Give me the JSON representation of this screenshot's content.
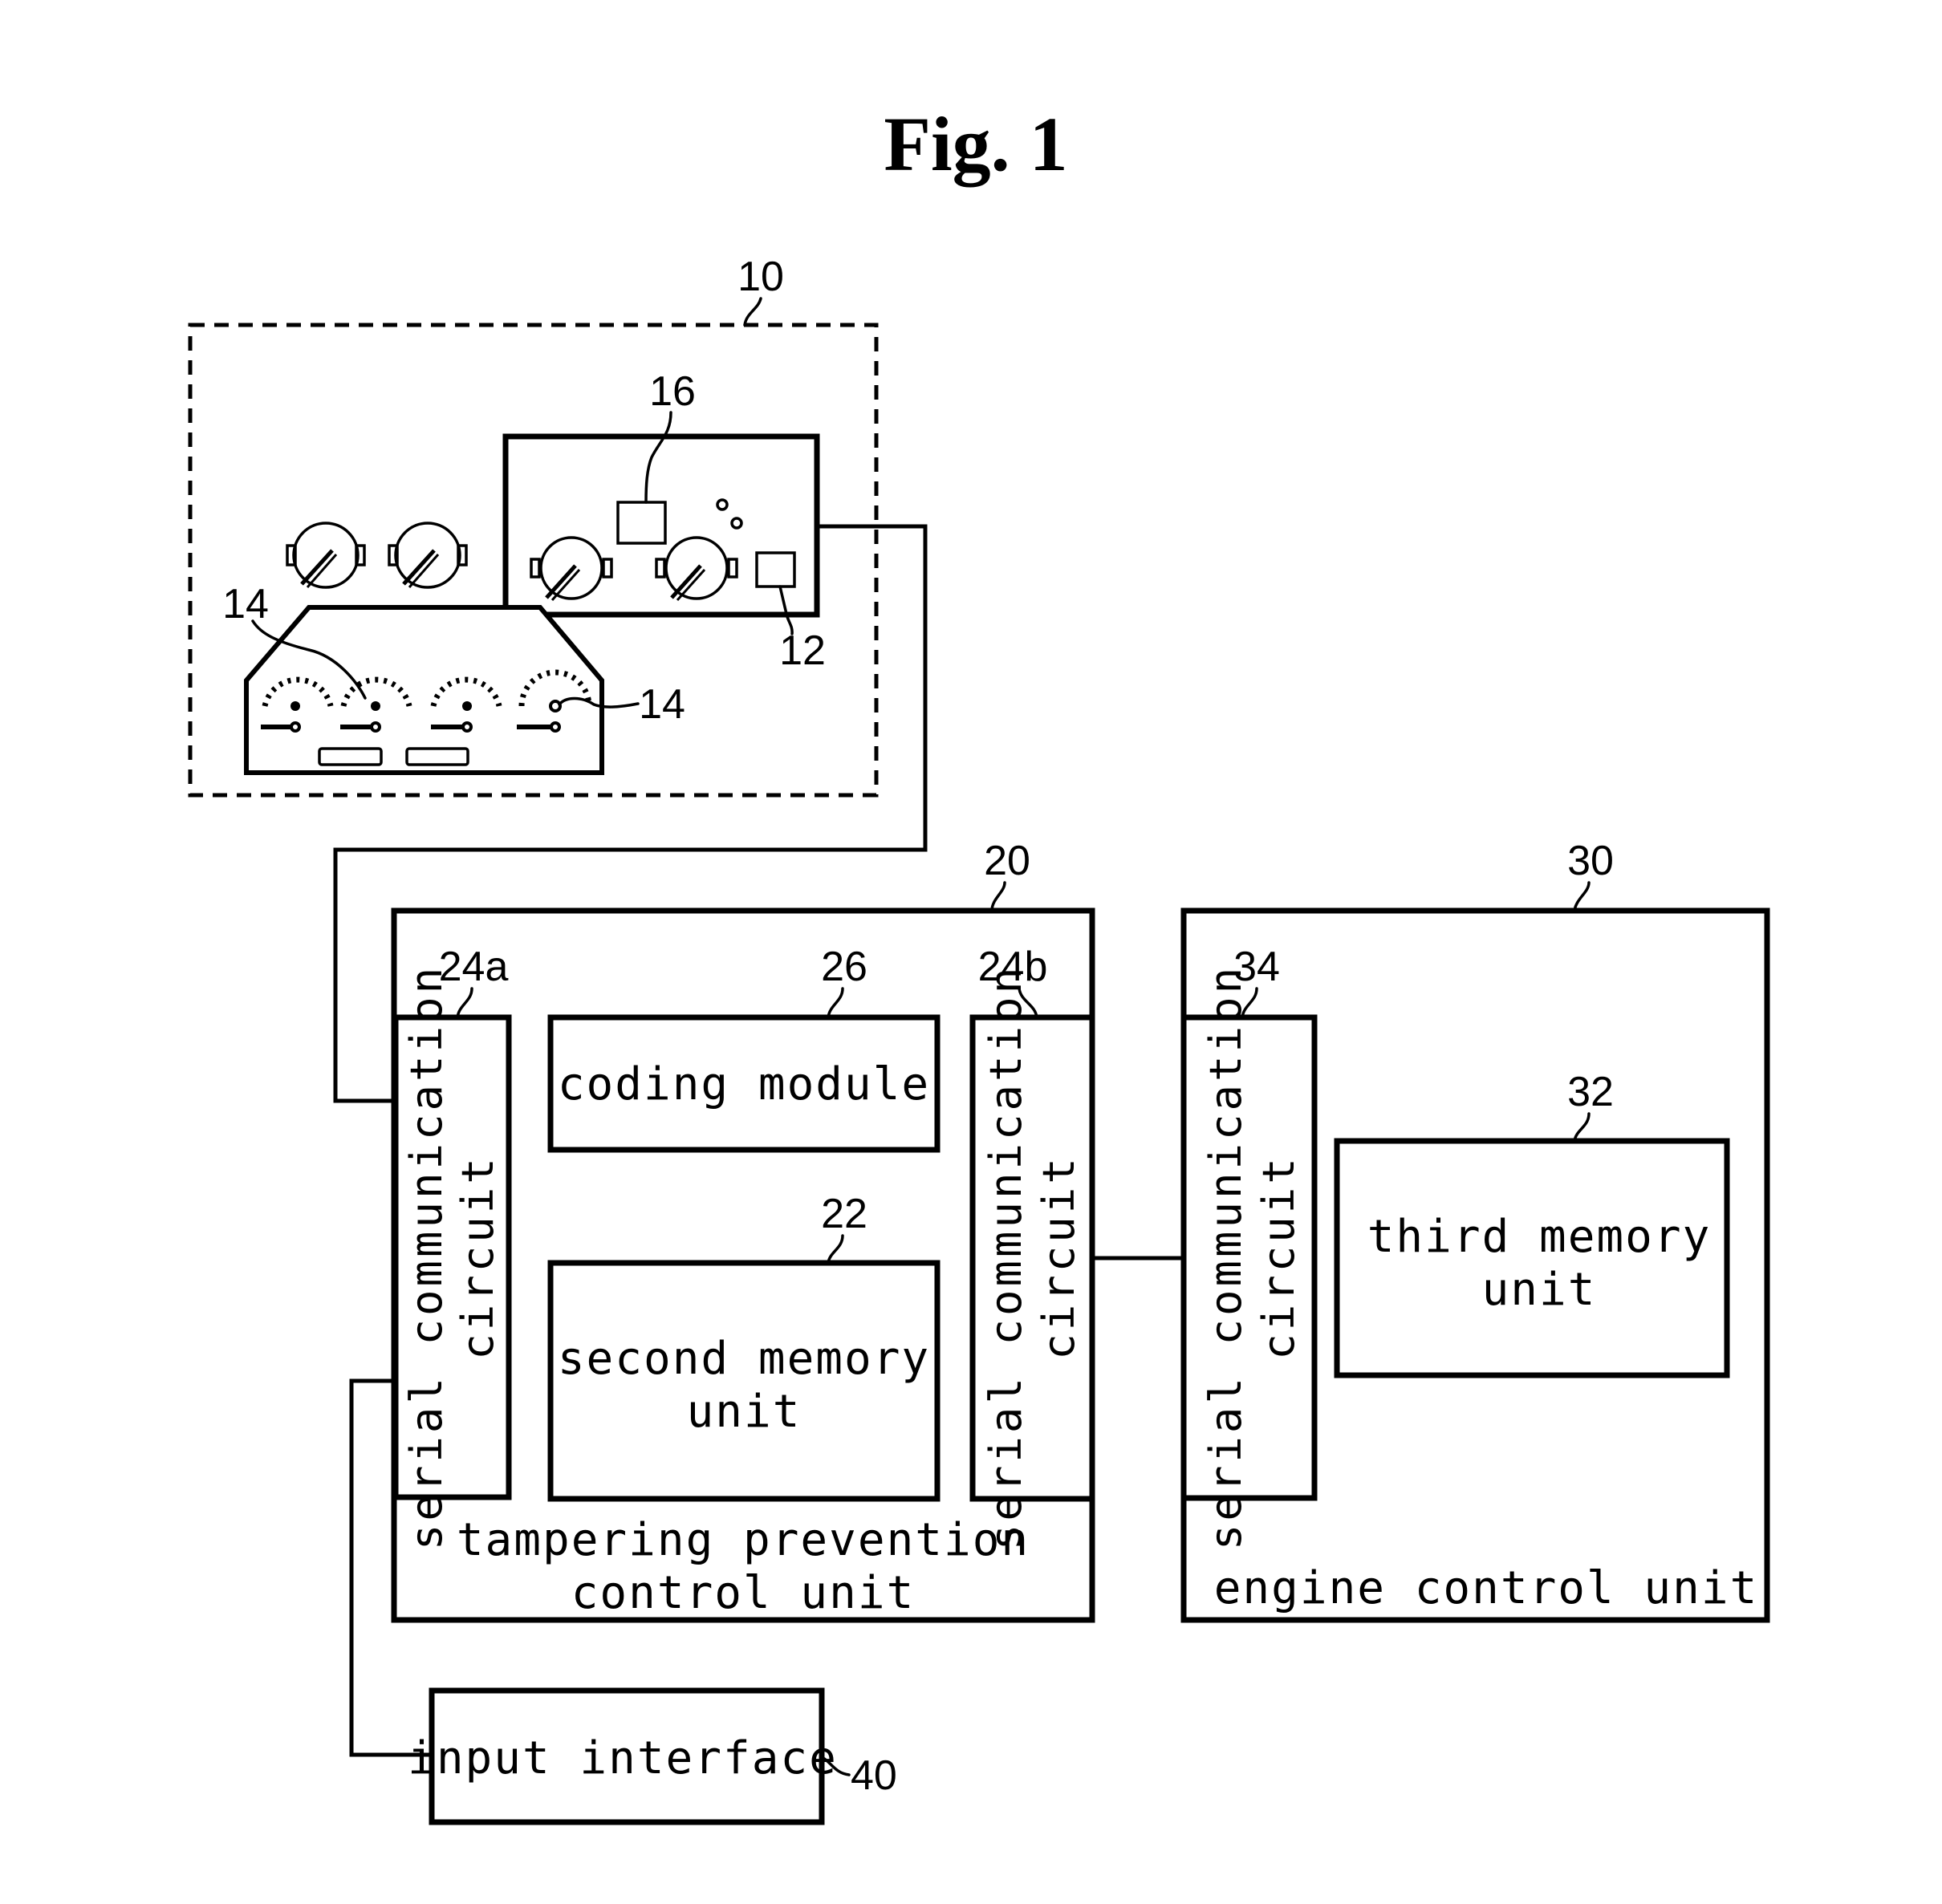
{
  "figure": {
    "title": "Fig. 1"
  },
  "refs": {
    "r10": "10",
    "r12": "12",
    "r14a": "14",
    "r14b": "14",
    "r16": "16",
    "r20": "20",
    "r22": "22",
    "r24a": "24a",
    "r24b": "24b",
    "r26": "26",
    "r30": "30",
    "r32": "32",
    "r34": "34",
    "r40": "40"
  },
  "blocks": {
    "tampering_unit": {
      "line1": "tampering prevention",
      "line2": "control unit"
    },
    "coding_module": "coding module",
    "second_memory": {
      "line1": "second memory",
      "line2": "unit"
    },
    "serial_a": {
      "line1": "serial communication",
      "line2": "circuit"
    },
    "serial_b": {
      "line1": "serial communication",
      "line2": "circuit"
    },
    "serial_ecu": {
      "line1": "serial communication",
      "line2": "circuit"
    },
    "engine_control_unit": "engine control unit",
    "third_memory": {
      "line1": "third memory",
      "line2": "unit"
    },
    "input_interface": "input interface"
  }
}
